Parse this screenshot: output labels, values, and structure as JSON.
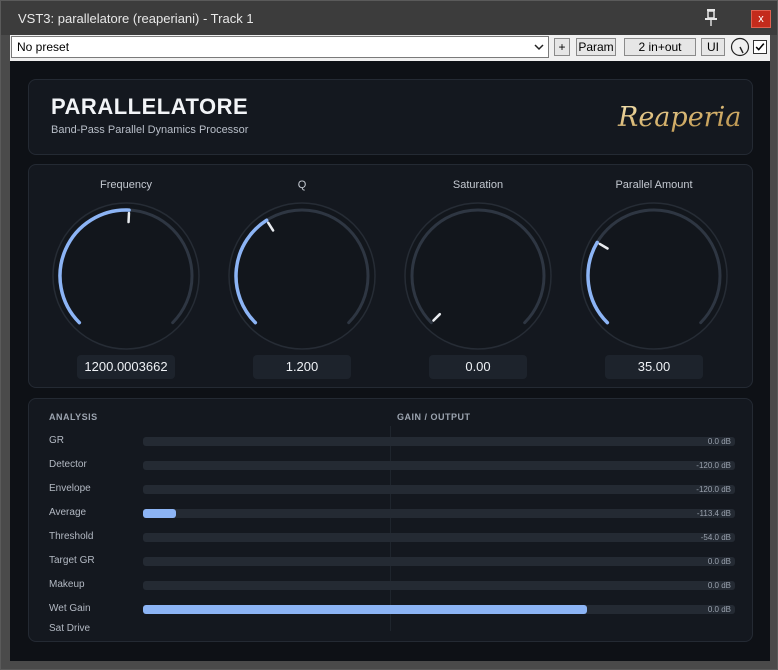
{
  "window": {
    "title": "VST3: parallelatore (reaperiani) - Track 1",
    "close_label": "x"
  },
  "toolbar": {
    "preset_value": "No preset",
    "add_label": "+",
    "param_label": "Param",
    "io_label": "2 in+out",
    "ui_label": "UI",
    "bypass_checked": true
  },
  "header": {
    "title": "PARALLELATORE",
    "subtitle": "Band-Pass Parallel Dynamics Processor",
    "logo_text": "Reaperiani"
  },
  "knobs": [
    {
      "label": "Frequency",
      "value": "1200.0003662",
      "fraction": 0.51
    },
    {
      "label": "Q",
      "value": "1.200",
      "fraction": 0.38
    },
    {
      "label": "Saturation",
      "value": "0.00",
      "fraction": 0.0
    },
    {
      "label": "Parallel Amount",
      "value": "35.00",
      "fraction": 0.28
    }
  ],
  "analysis": {
    "heading": "ANALYSIS",
    "output_heading": "GAIN / OUTPUT",
    "rows": [
      {
        "label": "GR",
        "value": "0.0 dB",
        "fill": 0
      },
      {
        "label": "Detector",
        "value": "-120.0 dB",
        "fill": 0
      },
      {
        "label": "Envelope",
        "value": "-120.0 dB",
        "fill": 0
      },
      {
        "label": "Average",
        "value": "-113.4 dB",
        "fill": 0.055
      },
      {
        "label": "Threshold",
        "value": "-54.0 dB",
        "fill": 0
      },
      {
        "label": "Target GR",
        "value": "0.0 dB",
        "fill": 0
      },
      {
        "label": "Makeup",
        "value": "0.0 dB",
        "fill": 0
      },
      {
        "label": "Wet Gain",
        "value": "0.0 dB",
        "fill": 0.75
      }
    ],
    "sat_label": "Sat Drive"
  },
  "colors": {
    "accent": "#8cb4f5",
    "track": "#2e3642",
    "indicator": "#e8ebef"
  }
}
